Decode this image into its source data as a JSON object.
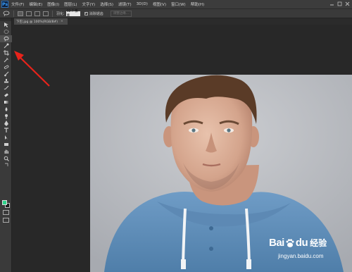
{
  "app": {
    "logo": "Ps"
  },
  "menu": [
    "文件(F)",
    "编辑(E)",
    "图像(I)",
    "图层(L)",
    "文字(Y)",
    "选择(S)",
    "滤镜(T)",
    "3D(D)",
    "视图(V)",
    "窗口(W)",
    "帮助(H)"
  ],
  "options": {
    "feather_label": "羽化:",
    "feather_value": "12.7 像素",
    "antialias_label": "消除锯齿",
    "antialias_checked": true,
    "refine_label": "调整边缘..."
  },
  "document": {
    "tab_title": "下巴.jpg @ 100%(RGB/8#)",
    "close": "×"
  },
  "tools": [
    "move-icon",
    "marquee-icon",
    "lasso-icon",
    "quick-select-icon",
    "crop-icon",
    "eyedropper-icon",
    "healing-icon",
    "brush-icon",
    "stamp-icon",
    "history-brush-icon",
    "eraser-icon",
    "gradient-icon",
    "blur-icon",
    "dodge-icon",
    "pen-icon",
    "type-icon",
    "path-select-icon",
    "shape-icon",
    "hand-icon",
    "zoom-icon"
  ],
  "colors": {
    "foreground": "#2ed38a",
    "background": "#1a1a1a",
    "annotation_arrow": "#e8231b"
  },
  "watermark": {
    "brand": "Bai",
    "brand_suffix": "du",
    "product": "经验",
    "url": "jingyan.baidu.com"
  }
}
